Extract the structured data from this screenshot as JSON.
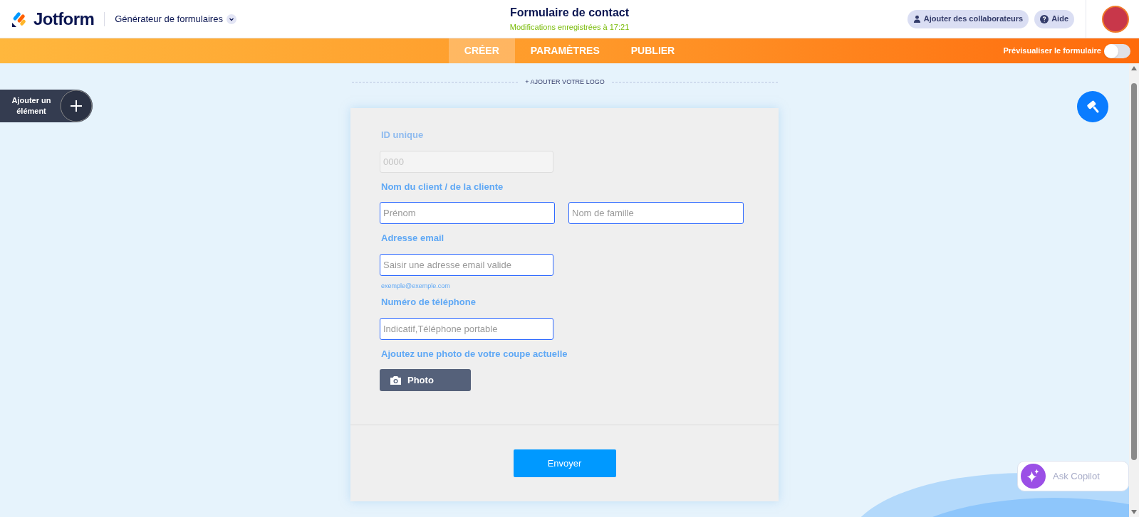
{
  "header": {
    "logo": "Jotform",
    "builder_menu": "Générateur de formulaires",
    "form_title": "Formulaire de contact",
    "save_status": "Modifications enregistrées à 17:21",
    "collaborators_button": "Ajouter des collaborateurs",
    "help_button": "Aide"
  },
  "tabs": [
    {
      "label": "CRÉER",
      "selected": true
    },
    {
      "label": "PARAMÈTRES",
      "selected": false
    },
    {
      "label": "PUBLIER",
      "selected": false
    }
  ],
  "preview_toggle": {
    "label": "Prévisualiser le formulaire",
    "on": false
  },
  "add_element_button": "Ajouter un élément",
  "add_logo": "+ AJOUTER VOTRE LOGO",
  "form_fields": [
    {
      "kind": "single",
      "label": "ID unique",
      "disabled": true,
      "placeholder": "0000"
    },
    {
      "kind": "double",
      "label": "Nom du client / de la cliente",
      "disabled": false,
      "placeholders": [
        "Prénom",
        "Nom de famille"
      ]
    },
    {
      "kind": "single",
      "label": "Adresse email",
      "disabled": false,
      "placeholder": "Saisir une adresse email valide",
      "sublabel": "exemple@exemple.com"
    },
    {
      "kind": "single",
      "label": "Numéro de téléphone",
      "disabled": false,
      "placeholder": "Indicatif,Téléphone portable"
    },
    {
      "kind": "upload",
      "label": "Ajoutez une photo de votre coupe actuelle",
      "disabled": false,
      "button": "Photo"
    }
  ],
  "submit_button": "Envoyer",
  "copilot": "Ask Copilot"
}
